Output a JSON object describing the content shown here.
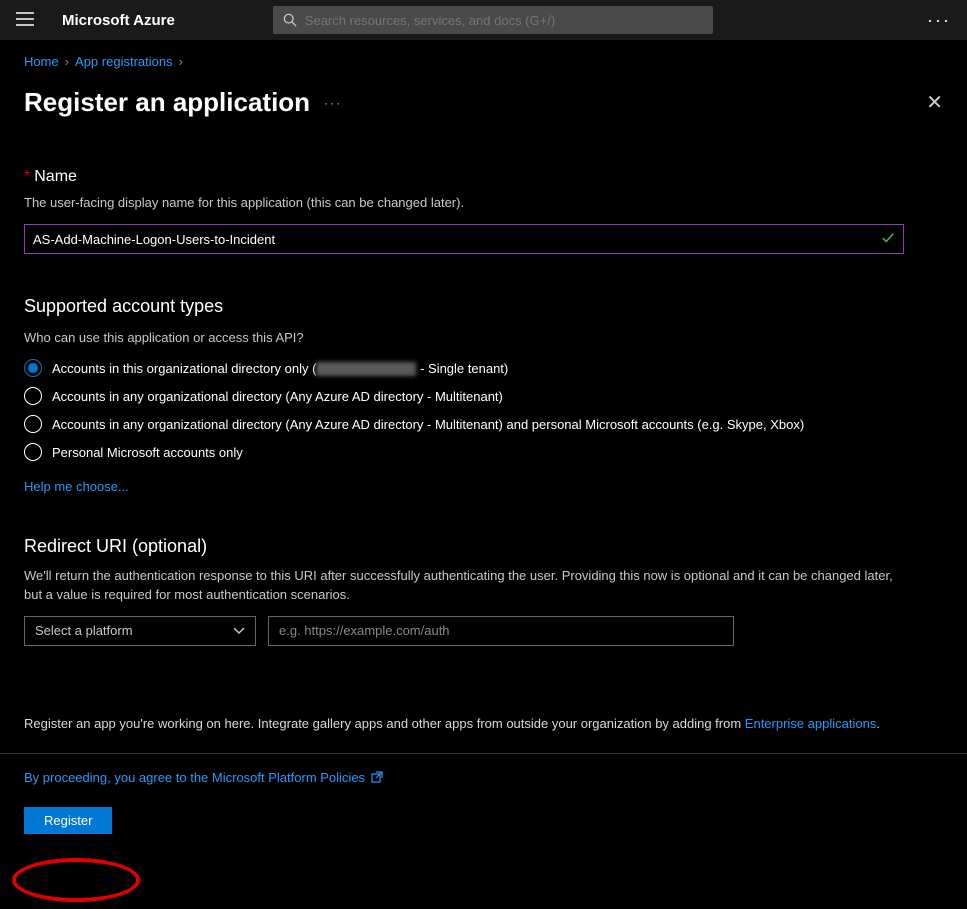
{
  "topbar": {
    "brand": "Microsoft Azure",
    "search_placeholder": "Search resources, services, and docs (G+/)"
  },
  "breadcrumbs": {
    "home": "Home",
    "app_reg": "App registrations"
  },
  "page_title": "Register an application",
  "name_section": {
    "label": "Name",
    "helper": "The user-facing display name for this application (this can be changed later).",
    "value": "AS-Add-Machine-Logon-Users-to-Incident"
  },
  "account_types": {
    "heading": "Supported account types",
    "question": "Who can use this application or access this API?",
    "options": [
      {
        "pre": "Accounts in this organizational directory only (",
        "post": " - Single tenant)",
        "redacted": true,
        "selected": true
      },
      {
        "text": "Accounts in any organizational directory (Any Azure AD directory - Multitenant)",
        "selected": false
      },
      {
        "text": "Accounts in any organizational directory (Any Azure AD directory - Multitenant) and personal Microsoft accounts (e.g. Skype, Xbox)",
        "selected": false
      },
      {
        "text": "Personal Microsoft accounts only",
        "selected": false
      }
    ],
    "help_link": "Help me choose..."
  },
  "redirect": {
    "heading": "Redirect URI (optional)",
    "helper": "We'll return the authentication response to this URI after successfully authenticating the user. Providing this now is optional and it can be changed later, but a value is required for most authentication scenarios.",
    "platform_placeholder": "Select a platform",
    "uri_placeholder": "e.g. https://example.com/auth"
  },
  "gallery_note": {
    "text": "Register an app you're working on here. Integrate gallery apps and other apps from outside your organization by adding from ",
    "link": "Enterprise applications",
    "suffix": "."
  },
  "footer": {
    "policy_text": "By proceeding, you agree to the Microsoft Platform Policies",
    "register_label": "Register"
  }
}
